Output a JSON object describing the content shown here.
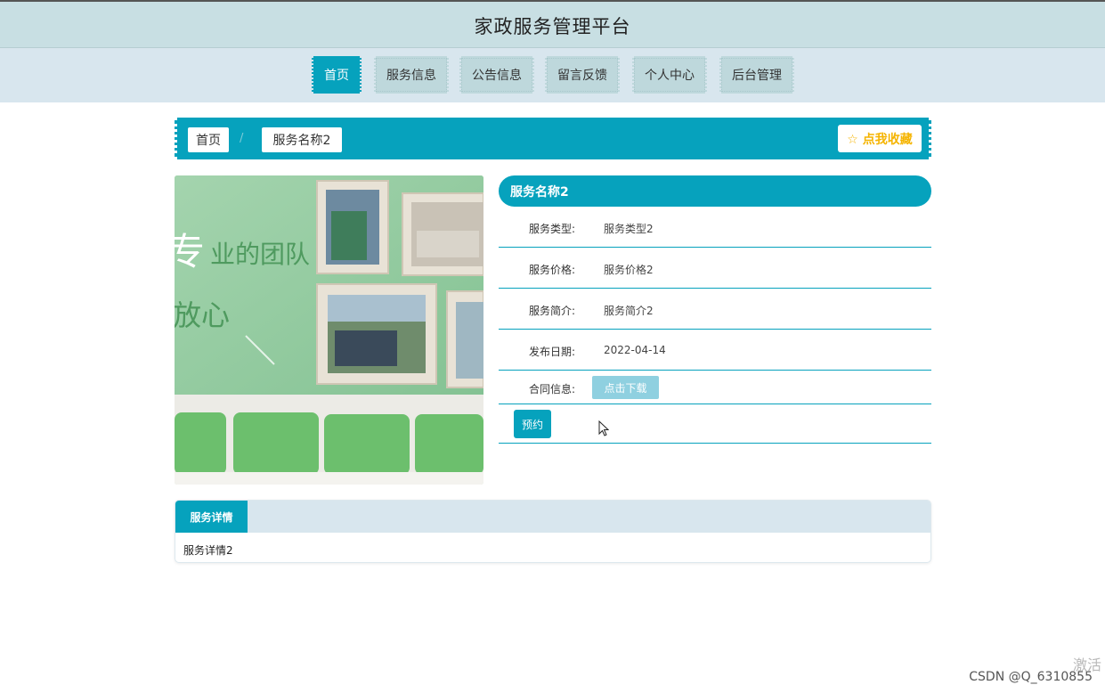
{
  "header": {
    "title": "家政服务管理平台"
  },
  "nav": {
    "items": [
      {
        "label": "首页"
      },
      {
        "label": "服务信息"
      },
      {
        "label": "公告信息"
      },
      {
        "label": "留言反馈"
      },
      {
        "label": "个人中心"
      },
      {
        "label": "后台管理"
      }
    ],
    "active_index": 0
  },
  "breadcrumb": {
    "home": "首页",
    "separator": "/",
    "current": "服务名称2",
    "favorite_label": "☆ 点我收藏"
  },
  "hero": {
    "text_line1": "业的团队",
    "text_line2": "放心",
    "partial_char": "专"
  },
  "info": {
    "title": "服务名称2",
    "rows": [
      {
        "label": "服务类型:",
        "value": "服务类型2"
      },
      {
        "label": "服务价格:",
        "value": "服务价格2"
      },
      {
        "label": "服务简介:",
        "value": "服务简介2"
      },
      {
        "label": "发布日期:",
        "value": "2022-04-14"
      }
    ],
    "contract_label": "合同信息:",
    "download_label": "点击下载",
    "book_label": "预约"
  },
  "detail": {
    "tab_label": "服务详情",
    "content": "服务详情2"
  },
  "overlay": {
    "activate_text": "激活",
    "csdn_credit": "CSDN @Q_6310855"
  },
  "colors": {
    "accent": "#06a2bd",
    "topbar_bg": "#c8dfe3",
    "navbar_bg": "#d8e6ee",
    "nav_item_bg": "#bed8dc",
    "favorite_text": "#f5b400"
  }
}
